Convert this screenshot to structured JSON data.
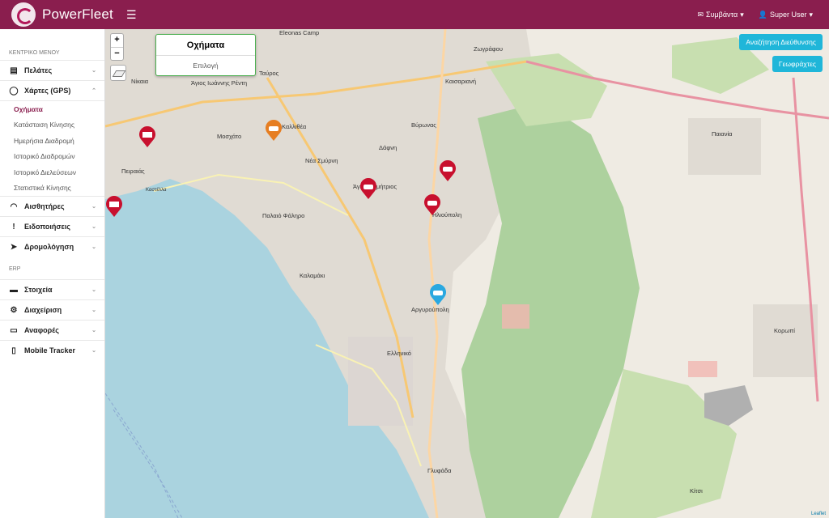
{
  "header": {
    "brand": "PowerFleet",
    "events_label": "Συμβάντα",
    "user_label": "Super User"
  },
  "sidebar": {
    "main_menu_heading": "ΚΕΝΤΡΙΚΟ ΜΕΝΟΥ",
    "erp_heading": "ERP",
    "items": [
      {
        "label": "Πελάτες"
      },
      {
        "label": "Χάρτες (GPS)"
      },
      {
        "label": "Αισθητήρες"
      },
      {
        "label": "Ειδοποιήσεις"
      },
      {
        "label": "Δρομολόγηση"
      },
      {
        "label": "Στοιχεία"
      },
      {
        "label": "Διαχείριση"
      },
      {
        "label": "Αναφορές"
      },
      {
        "label": "Mobile Tracker"
      }
    ],
    "gps_subitems": [
      {
        "label": "Οχήματα"
      },
      {
        "label": "Κατάσταση Κίνησης"
      },
      {
        "label": "Ημερήσια Διαδρομή"
      },
      {
        "label": "Ιστορικό Διαδρομών"
      },
      {
        "label": "Ιστορικό Διελεύσεων"
      },
      {
        "label": "Στατιστικά Κίνησης"
      }
    ]
  },
  "map": {
    "zoom_in": "+",
    "zoom_out": "−",
    "vehicles_panel_title": "Οχήματα",
    "vehicles_panel_select": "Επιλογή",
    "address_search_button": "Αναζήτηση Διεύθυνσης",
    "geofences_button": "Γεωφράχτες",
    "attribution": "Leaflet",
    "places": [
      "Eleonas Camp",
      "Ζωγράφου",
      "Νίκαια",
      "Άγιος Ιωάννης Ρέντη",
      "Ταύρος",
      "Καισαριανή",
      "Καλλιθέα",
      "Μοσχάτο",
      "Βύρωνας",
      "Πειραιάς",
      "Νέα Σμύρνη",
      "Δάφνη",
      "Παιανία",
      "Άγιος Δημήτριος",
      "Ηλιούπολη",
      "Παλαιό Φάληρο",
      "Καλαμάκι",
      "Αργυρούπολη",
      "Ελληνικό",
      "Κορωπί",
      "Γλυφάδα",
      "Κίτσι",
      "Καστέλλα"
    ]
  },
  "colors": {
    "header_bg": "#8a1e4e",
    "accent": "#8a1e4e",
    "button_blue": "#1fb6d9",
    "marker_red": "#c8102e",
    "marker_orange": "#e67e22",
    "marker_blue": "#2aa8e0",
    "sea": "#aad3df",
    "forest": "#add19e"
  }
}
